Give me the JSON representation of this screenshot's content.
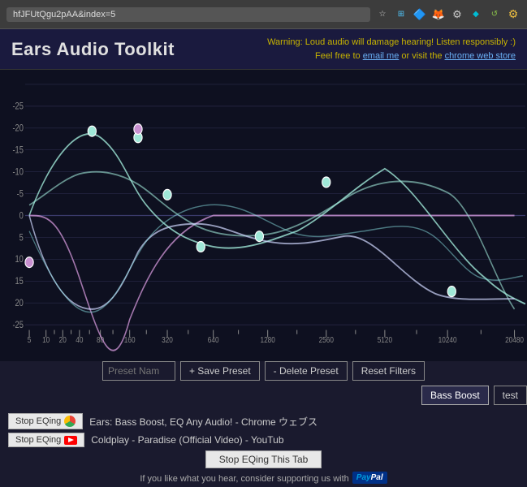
{
  "browser": {
    "address": "hfJFUtQgu2pAA&index=5"
  },
  "header": {
    "title": "Ears Audio Toolkit",
    "warning_line1": "Warning: Loud audio will damage hearing! Listen responsibly :)",
    "warning_line2_pre": "Feel free to ",
    "warning_link1": "email me",
    "warning_line2_mid": " or visit the ",
    "warning_link2": "chrome web store"
  },
  "controls": {
    "preset_placeholder": "Preset Nam",
    "save_preset": "+ Save Preset",
    "delete_preset": "- Delete Preset",
    "reset_filters": "Reset Filters",
    "bass_boost": "Bass Boost",
    "test": "test"
  },
  "tabs": [
    {
      "stop_eq_label": "Stop EQing 🎵",
      "link_text": "Ears: Bass Boost, EQ Any Audio! - Chrome ウェブス"
    },
    {
      "stop_eq_label": "Stop EQing",
      "link_text": "Coldplay - Paradise (Official Video) - YouTub"
    }
  ],
  "stop_eq_tab_btn": "Stop EQing This Tab",
  "footer": "If you like what you hear, consider supporting us with",
  "paypal": "PayPal",
  "eq_graph": {
    "y_labels": [
      "-25",
      "-20",
      "-15",
      "-10",
      "-5",
      "0",
      "5",
      "10",
      "15",
      "20",
      "-25"
    ],
    "x_labels": [
      "5",
      "10",
      "20",
      "40",
      "80",
      "160",
      "320",
      "640",
      "1280",
      "2560",
      "5120",
      "10240",
      "20480"
    ],
    "curves": [
      {
        "color": "#a0e0d0",
        "points": "start"
      },
      {
        "color": "#c8a0d0",
        "points": "mid"
      }
    ]
  }
}
